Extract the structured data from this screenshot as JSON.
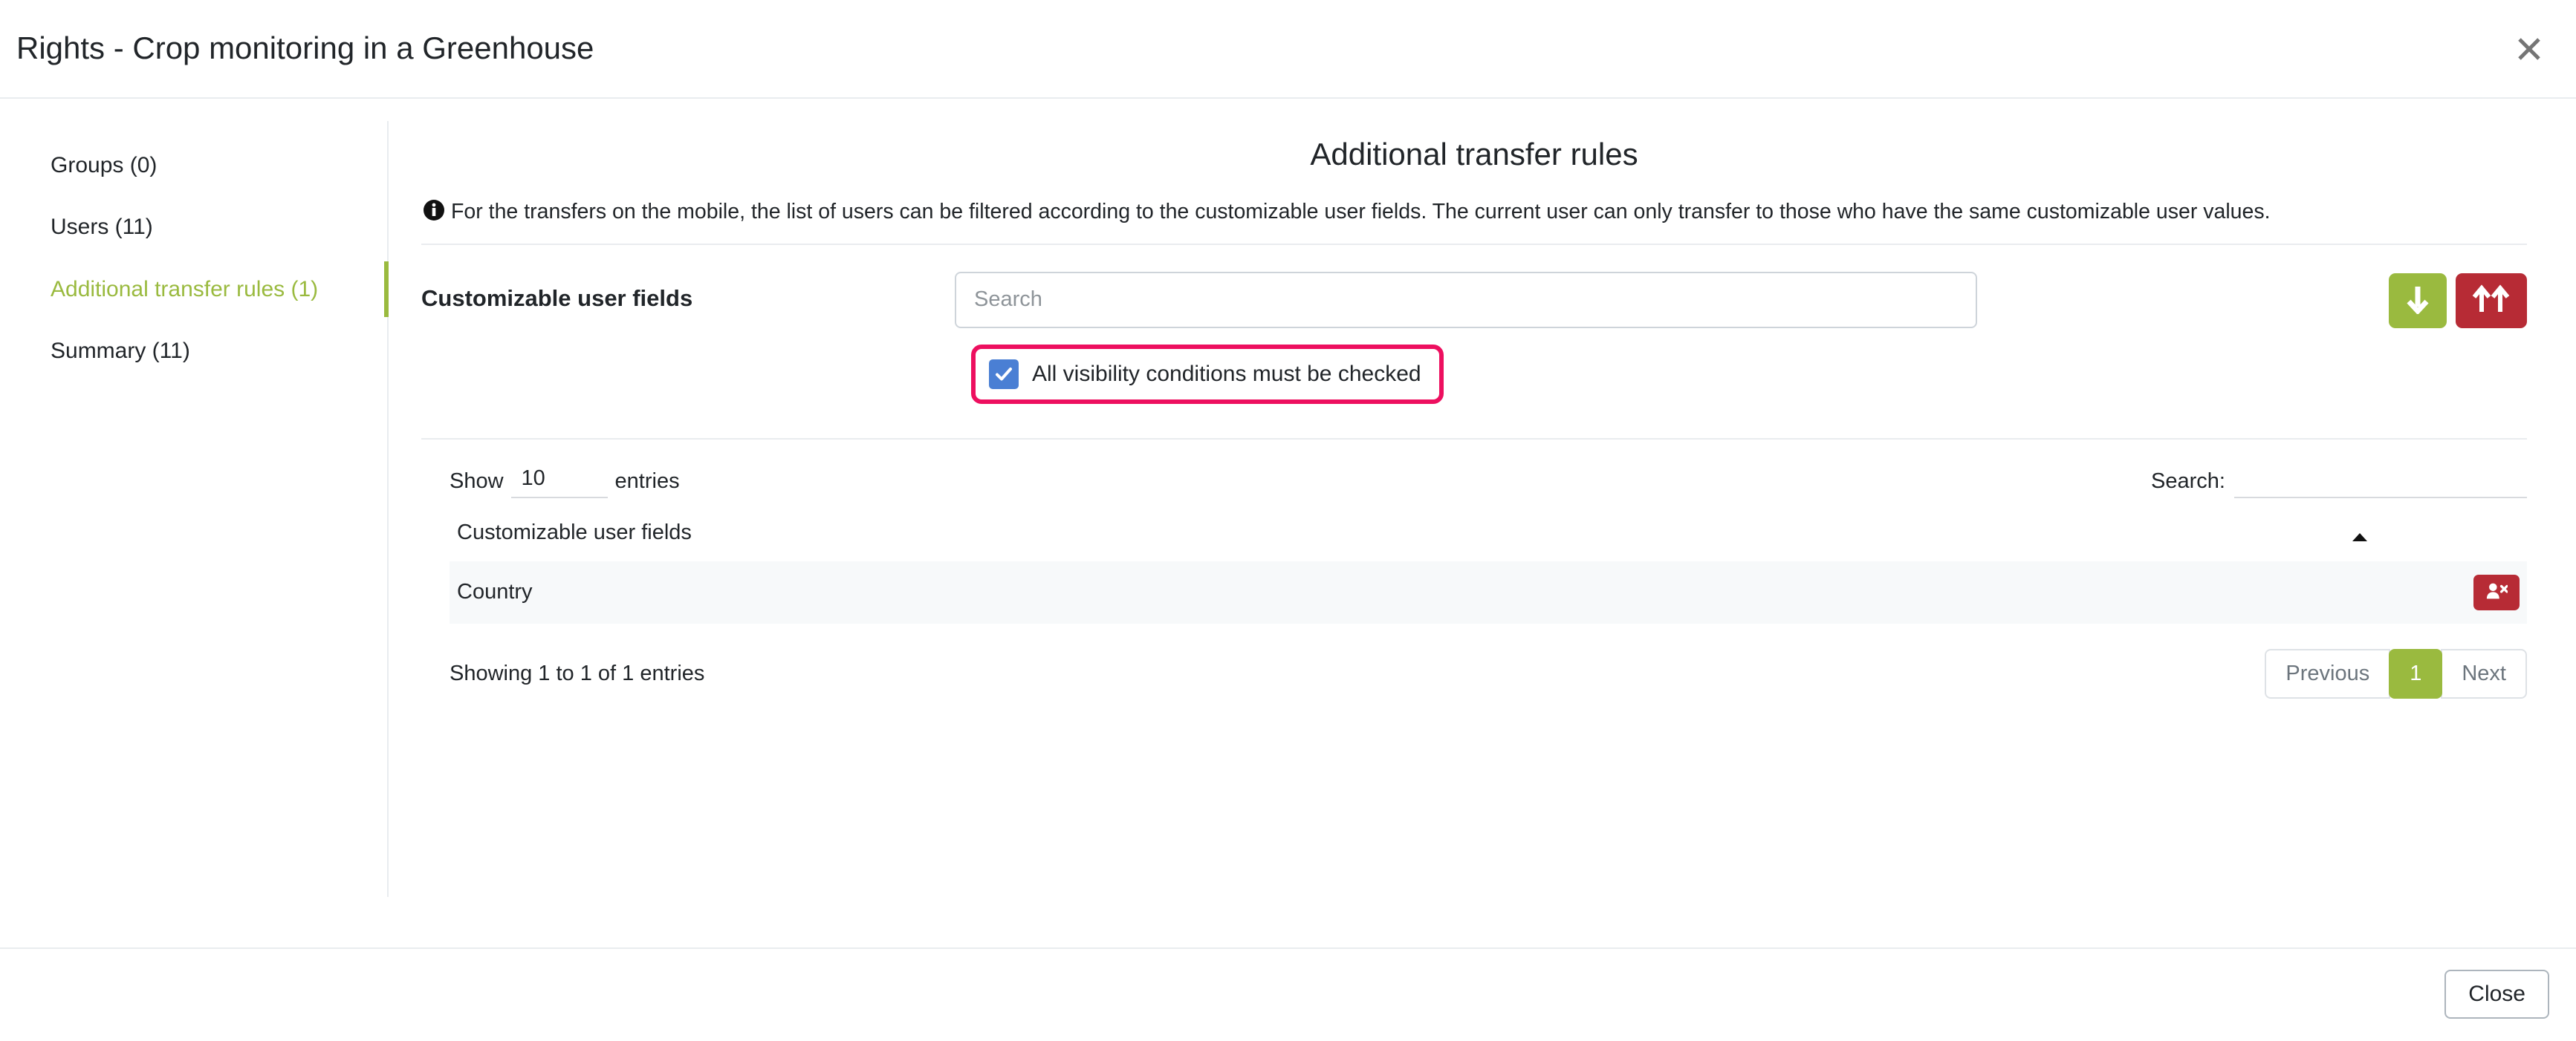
{
  "header": {
    "title": "Rights - Crop monitoring in a Greenhouse",
    "close_icon": "close-icon"
  },
  "sidebar": {
    "items": [
      {
        "label": "Groups (0)",
        "active": false
      },
      {
        "label": "Users (11)",
        "active": false
      },
      {
        "label": "Additional transfer rules (1)",
        "active": true
      },
      {
        "label": "Summary (11)",
        "active": false
      }
    ]
  },
  "main": {
    "title": "Additional transfer rules",
    "info_icon": "info-circle-icon",
    "info_text": "For the transfers on the mobile, the list of users can be filtered according to the customizable user fields. The current user can only transfer to those who have the same customizable user values.",
    "field": {
      "label": "Customizable user fields",
      "search_placeholder": "Search",
      "search_value": "",
      "add_button_icon": "arrow-down-icon",
      "remove_button_icon": "double-arrow-up-icon"
    },
    "checkbox": {
      "label": "All visibility conditions must be checked",
      "checked": true,
      "highlight_color": "#ed0f5f"
    }
  },
  "table": {
    "length_prefix": "Show",
    "length_value": "10",
    "length_suffix": "entries",
    "filter_label": "Search:",
    "filter_value": "",
    "columns": [
      "Customizable user fields"
    ],
    "sort_icon": "caret-up-icon",
    "rows": [
      {
        "name": "Country",
        "action_icon": "user-remove-icon"
      }
    ],
    "info": "Showing 1 to 1 of 1 entries",
    "pagination": {
      "previous": "Previous",
      "pages": [
        "1"
      ],
      "next": "Next",
      "active_page": "1"
    }
  },
  "footer": {
    "close_label": "Close"
  },
  "colors": {
    "accent_green": "#9aba3f",
    "danger_red": "#b72b35",
    "highlight_pink": "#ed0f5f",
    "checkbox_blue": "#4a7fd4"
  }
}
